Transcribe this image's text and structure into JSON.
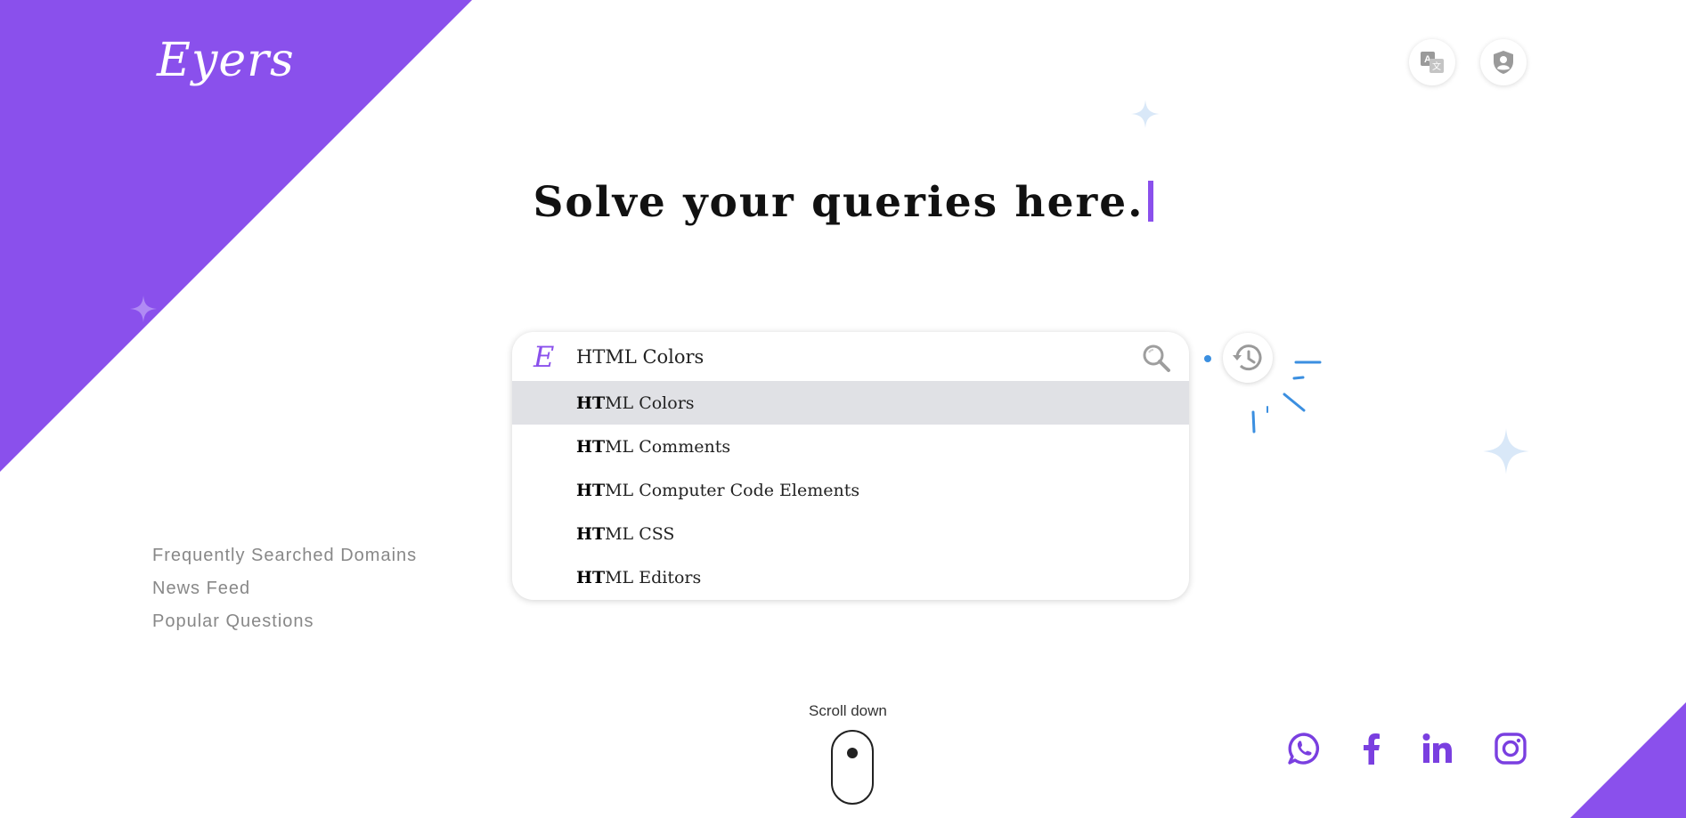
{
  "brand": {
    "logo": "Eyers",
    "search_mark": "E"
  },
  "header": {
    "translate_icon": "translate-icon",
    "privacy_icon": "shield-user-icon"
  },
  "hero": {
    "headline": "Solve your queries here."
  },
  "search": {
    "value": "HTML Colors",
    "query_prefix": "HT",
    "suggestions": [
      {
        "match": "HT",
        "rest": "ML Colors",
        "active": true
      },
      {
        "match": "HT",
        "rest": "ML Comments",
        "active": false
      },
      {
        "match": "HT",
        "rest": "ML Computer Code Elements",
        "active": false
      },
      {
        "match": "HT",
        "rest": "ML CSS",
        "active": false
      },
      {
        "match": "HT",
        "rest": "ML Editors",
        "active": false
      }
    ]
  },
  "history": {
    "icon": "history-icon"
  },
  "side_links": [
    {
      "label": "Frequently Searched Domains"
    },
    {
      "label": "News Feed"
    },
    {
      "label": "Popular Questions"
    }
  ],
  "scroll": {
    "label": "Scroll down"
  },
  "social": [
    {
      "name": "whatsapp-icon"
    },
    {
      "name": "facebook-icon"
    },
    {
      "name": "linkedin-icon"
    },
    {
      "name": "instagram-icon"
    }
  ],
  "colors": {
    "accent": "#8a50ec",
    "highlight_row": "#e0e1e5",
    "sparkle_light": "#d9e8f8",
    "confetti": "#3b8fe0"
  }
}
